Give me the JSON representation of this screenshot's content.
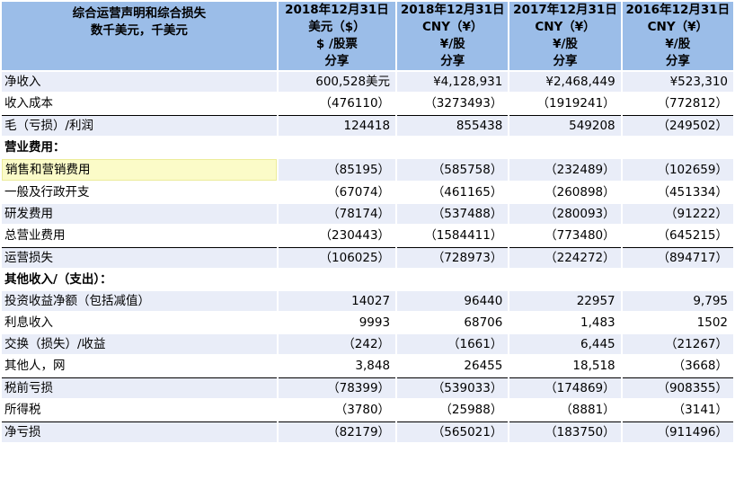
{
  "header": {
    "title_line1": "综合运营声明和综合损失",
    "title_line2": "数千美元，千美元",
    "columns": [
      {
        "date": "2018年12月31日",
        "currency": "美元（$）",
        "unit": "$ /股票",
        "share": "分享"
      },
      {
        "date": "2018年12月31日",
        "currency": "CNY（¥）",
        "unit": "¥/股",
        "share": "分享"
      },
      {
        "date": "2017年12月31日",
        "currency": "CNY（¥）",
        "unit": "¥/股",
        "share": "分享"
      },
      {
        "date": "2016年12月31日",
        "currency": "CNY（¥）",
        "unit": "¥/股",
        "share": "分享"
      }
    ]
  },
  "rows": [
    {
      "label": "净收入",
      "values": [
        "600,528美元",
        "¥4,128,931",
        "¥2,468,449",
        "¥523,310"
      ]
    },
    {
      "label": "收入成本",
      "values": [
        "（476110）",
        "（3273493）",
        "（1919241）",
        "（772812）"
      ]
    },
    {
      "label": "毛（亏损）/利润",
      "values": [
        "124418",
        "855438",
        "549208",
        "（249502）"
      ]
    },
    {
      "label": "营业费用：",
      "values": [
        "",
        "",
        "",
        ""
      ]
    },
    {
      "label": "销售和营销费用",
      "values": [
        "（85195）",
        "（585758）",
        "（232489）",
        "（102659）"
      ]
    },
    {
      "label": "一般及行政开支",
      "values": [
        "（67074）",
        "（461165）",
        "（260898）",
        "（451334）"
      ]
    },
    {
      "label": "研发费用",
      "values": [
        "（78174）",
        "（537488）",
        "（280093）",
        "（91222）"
      ]
    },
    {
      "label": "总营业费用",
      "values": [
        "（230443）",
        "（1584411）",
        "（773480）",
        "（645215）"
      ]
    },
    {
      "label": "运营损失",
      "values": [
        "（106025）",
        "（728973）",
        "（224272）",
        "（894717）"
      ]
    },
    {
      "label": "其他收入/（支出）：",
      "values": [
        "",
        "",
        "",
        ""
      ]
    },
    {
      "label": "投资收益净额（包括减值）",
      "values": [
        "14027",
        "96440",
        "22957",
        "9,795"
      ]
    },
    {
      "label": "利息收入",
      "values": [
        "9993",
        "68706",
        "1,483",
        "1502"
      ]
    },
    {
      "label": "交换（损失）/收益",
      "values": [
        "（242）",
        "（1661）",
        "6,445",
        "（21267）"
      ]
    },
    {
      "label": "其他人，网",
      "values": [
        "3,848",
        "26455",
        "18,518",
        "（3668）"
      ]
    },
    {
      "label": "税前亏损",
      "values": [
        "（78399）",
        "（539033）",
        "（174869）",
        "（908355）"
      ]
    },
    {
      "label": "所得税",
      "values": [
        "（3780）",
        "（25988）",
        "（8881）",
        "（3141）"
      ]
    },
    {
      "label": "净亏损",
      "values": [
        "（82179）",
        "（565021）",
        "（183750）",
        "（911496）"
      ]
    }
  ]
}
